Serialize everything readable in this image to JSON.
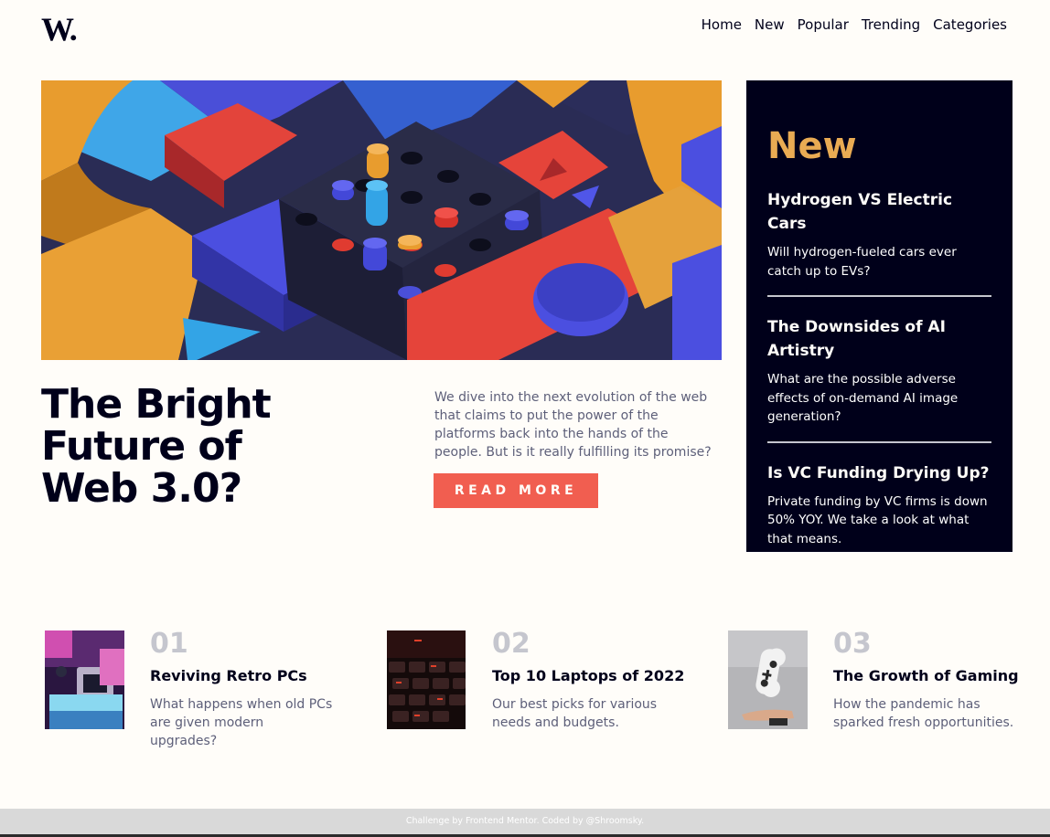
{
  "header": {
    "logo": "W.",
    "nav": [
      "Home",
      "New",
      "Popular",
      "Trending",
      "Categories"
    ]
  },
  "hero": {
    "title": "The Bright Future of Web 3.0?",
    "description": "We dive into the next evolution of the web that claims to put the power of the platforms back into the hands of the people. But is it really fulfilling its promise?",
    "button_label": "READ MORE"
  },
  "new_panel": {
    "heading": "New",
    "items": [
      {
        "title": "Hydrogen VS Electric Cars",
        "text": "Will hydrogen-fueled cars ever catch up to EVs?"
      },
      {
        "title": "The Downsides of AI Artistry",
        "text": "What are the possible adverse effects of on-demand AI image generation?"
      },
      {
        "title": "Is VC Funding Drying Up?",
        "text": "Private funding by VC firms is down 50% YOY. We take a look at what that means."
      }
    ]
  },
  "cards": [
    {
      "number": "01",
      "title": "Reviving Retro PCs",
      "text": "What happens when old PCs are given modern upgrades?"
    },
    {
      "number": "02",
      "title": "Top 10 Laptops of 2022",
      "text": "Our best picks for various needs and budgets."
    },
    {
      "number": "03",
      "title": "The Growth of Gaming",
      "text": "How the pandemic has sparked fresh opportunities."
    }
  ],
  "footer": {
    "text": "Challenge by Frontend Mentor. Coded by @Shroomsky."
  },
  "colors": {
    "accent_orange": "#e9ab53",
    "accent_red": "#f15e50",
    "dark_navy": "#00001a",
    "off_white": "#fffdf9",
    "grey_blue": "#5d5f79"
  }
}
